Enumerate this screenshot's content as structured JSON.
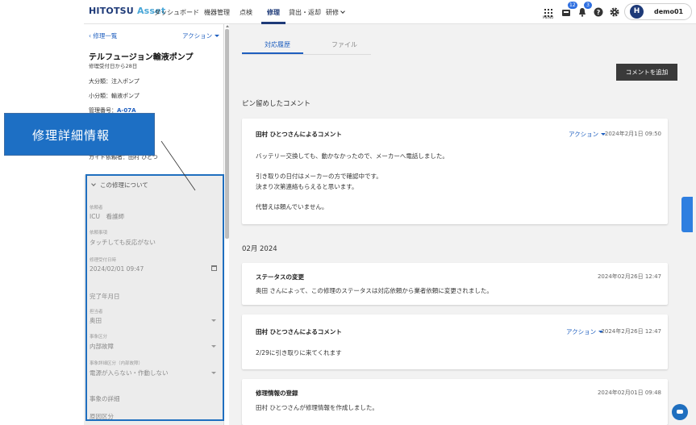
{
  "header": {
    "logo_main": "HITOTSU",
    "logo_accent": "Asset",
    "nav": [
      "ダッシュボード",
      "機器管理",
      "点検",
      "修理",
      "貸出・返却",
      "研修"
    ],
    "menu_label": "MENU",
    "badges": [
      "12",
      "3"
    ],
    "user": {
      "initial": "H",
      "name": "demo01"
    }
  },
  "left": {
    "back_link": "修理一覧",
    "action_link": "アクション",
    "device_name": "テルフュージョン輸液ポンプ",
    "elapsed": "修理受付日から28日",
    "category_major": "大分類：注入ポンプ",
    "category_minor": "小分類：輸液ポンプ",
    "management_label": "管理番号：",
    "management_no": "A-07A",
    "partial_line": "ガイド依頼者：田村 ひとつ"
  },
  "callout": {
    "text": "修理詳細情報"
  },
  "repair": {
    "title": "この修理について",
    "fields": [
      {
        "label": "依頼者",
        "value": "ICU　看護師"
      },
      {
        "label": "依頼事項",
        "value": "タッチしても反応がない"
      },
      {
        "label": "修理受付日時",
        "value": "2024/02/01  09:47"
      },
      {
        "label": "",
        "value": "完了年月日"
      },
      {
        "label": "担当者",
        "value": "奥田"
      },
      {
        "label": "事象区分",
        "value": "内部故障"
      },
      {
        "label": "事象詳細区分（内部故障）",
        "value": "電源が入らない・作動しない"
      },
      {
        "label": "",
        "value": "事象の詳細"
      },
      {
        "label": "",
        "value": "原因区分"
      }
    ]
  },
  "main": {
    "tabs": [
      "対応履歴",
      "ファイル"
    ],
    "add_comment": "コメントを追加",
    "pinned_title": "ピン留めしたコメント",
    "pinned": {
      "author": "田村 ひとつさんによるコメント",
      "action": "アクション",
      "date": "2024年2月1日 09:50",
      "lines": [
        "バッテリー交換しても、動かなかったので、メーカーへ電話しました。",
        "引き取りの日付はメーカーの方で確認中です。",
        "決まり次第連絡もらえると思います。",
        "代替えは頼んでいません。"
      ]
    },
    "month_label": "02月 2024",
    "history": [
      {
        "title": "ステータスの変更",
        "date": "2024年02月26日 12:47",
        "text": "奥田 さんによって、この修理のステータスは対応依頼から業者依頼に変更されました。"
      },
      {
        "title": "田村 ひとつさんによるコメント",
        "action": "アクション",
        "date": "2024年2月26日 12:47",
        "text": "2/29に引き取りに来てくれます"
      },
      {
        "title": "修理情報の登録",
        "date": "2024年02月01日 09:48",
        "text": "田村 ひとつさんが修理情報を作成しました。"
      }
    ]
  }
}
